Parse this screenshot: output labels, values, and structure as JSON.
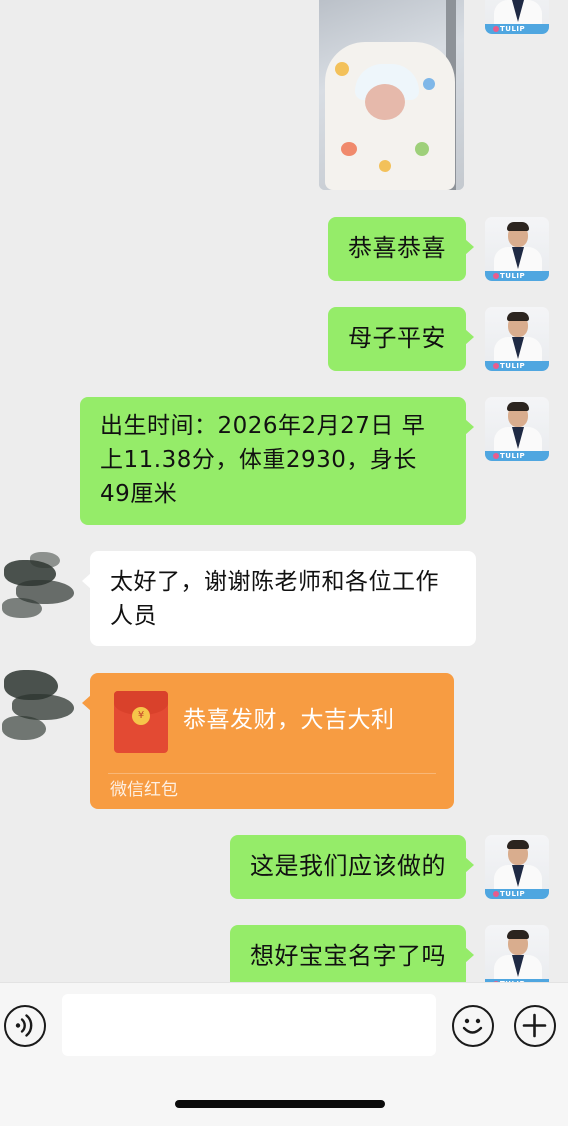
{
  "messages": {
    "m1": "恭喜恭喜",
    "m2": "母子平安",
    "m3": "出生时间：2026年2月27日 早上11.38分，体重2930，身长49厘米",
    "m4": "太好了，谢谢陈老师和各位工作人员",
    "m5": "这是我们应该做的",
    "m6": "想好宝宝名字了吗"
  },
  "red_packet": {
    "title": "恭喜发财，大吉大利",
    "label": "微信红包",
    "coin_symbol": "¥"
  },
  "avatar": {
    "tag": "TULIP"
  },
  "input": {
    "placeholder": ""
  },
  "colors": {
    "my_bubble": "#95ec69",
    "their_bubble": "#ffffff",
    "red_packet": "#f79c42",
    "background": "#ededed"
  },
  "icons": [
    "voice-icon",
    "emoji-icon",
    "plus-icon"
  ]
}
